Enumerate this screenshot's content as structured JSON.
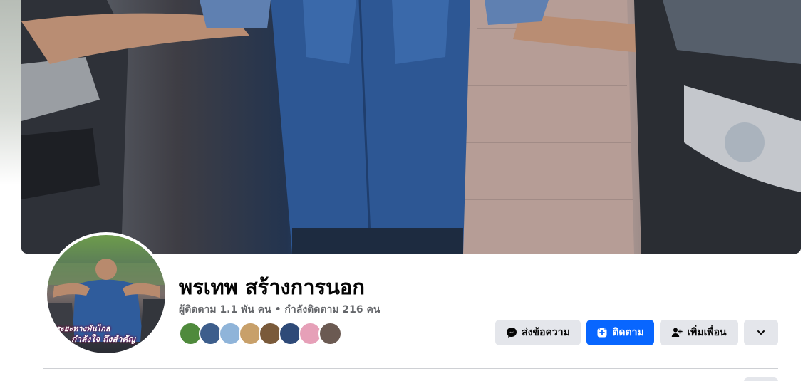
{
  "profile": {
    "name": "พรเทพ สร้างการนอก",
    "stats": "ผู้ติดตาม 1.1 พัน คน • กำลังติดตาม 216 คน",
    "avatar_caption_line1": "ระยะทางพันไกล",
    "avatar_caption_line2": "กำลังใจ ถึงสำคัญ"
  },
  "friends": [
    {
      "icon": "friend-avatar-1",
      "color": "#4f8a3c"
    },
    {
      "icon": "friend-avatar-2",
      "color": "#3d5e8c"
    },
    {
      "icon": "friend-avatar-3",
      "color": "#8fb4d9"
    },
    {
      "icon": "friend-avatar-4",
      "color": "#c8a06a"
    },
    {
      "icon": "friend-avatar-5",
      "color": "#7a5a3a"
    },
    {
      "icon": "friend-avatar-6",
      "color": "#2e4a78"
    },
    {
      "icon": "friend-avatar-7",
      "color": "#e6a0b8"
    },
    {
      "icon": "friend-avatar-8",
      "color": "#6b5a52"
    }
  ],
  "actions": {
    "message_label": "ส่งข้อความ",
    "follow_label": "ติดตาม",
    "add_friend_label": "เพิ่มเพื่อน"
  },
  "colors": {
    "primary_button": "#0866ff",
    "secondary_button": "#e4e6eb",
    "text_primary": "#050505",
    "text_secondary": "#65676b"
  }
}
